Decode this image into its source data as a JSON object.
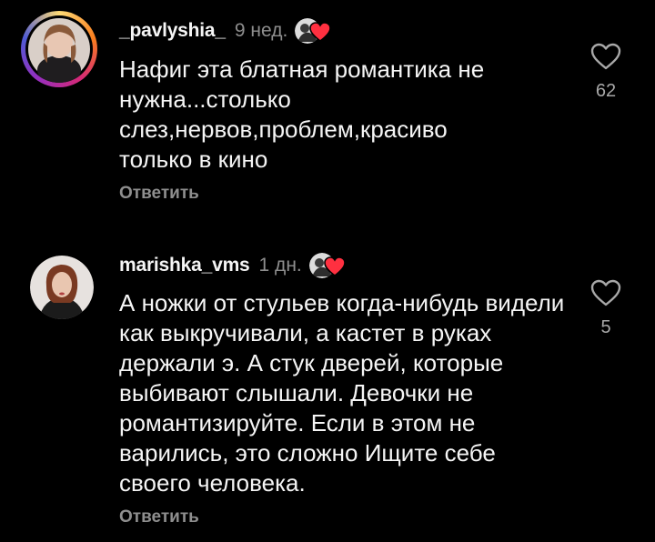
{
  "comments": [
    {
      "username": "_pavlyshia_",
      "time": "9 нед.",
      "text": "Нафиг эта блатная романтика не нужна...столько слез,нервов,проблем,красиво только в кино",
      "reply_label": "Ответить",
      "like_count": "62",
      "has_story_ring": true,
      "author_liked": true
    },
    {
      "username": "marishka_vms",
      "time": "1 дн.",
      "text": "А ножки от стульев когда-нибудь видели как выкручивали, а кастет в руках держали э. А стук дверей, которые выбивают слышали. Девочки не романтизируйте. Если в этом не варились, это сложно Ищите себе своего человека.",
      "reply_label": "Ответить",
      "like_count": "5",
      "has_story_ring": false,
      "author_liked": true
    }
  ],
  "colors": {
    "background": "#000000",
    "text": "#f5f5f5",
    "muted": "#8e8e8e",
    "heart_red": "#ff3040",
    "story_ring": [
      "#feda75",
      "#fa7e1e",
      "#d62976",
      "#962fbf"
    ]
  },
  "icons": {
    "like": "heart-outline-icon",
    "author_like": "author-liked-heart-icon"
  }
}
